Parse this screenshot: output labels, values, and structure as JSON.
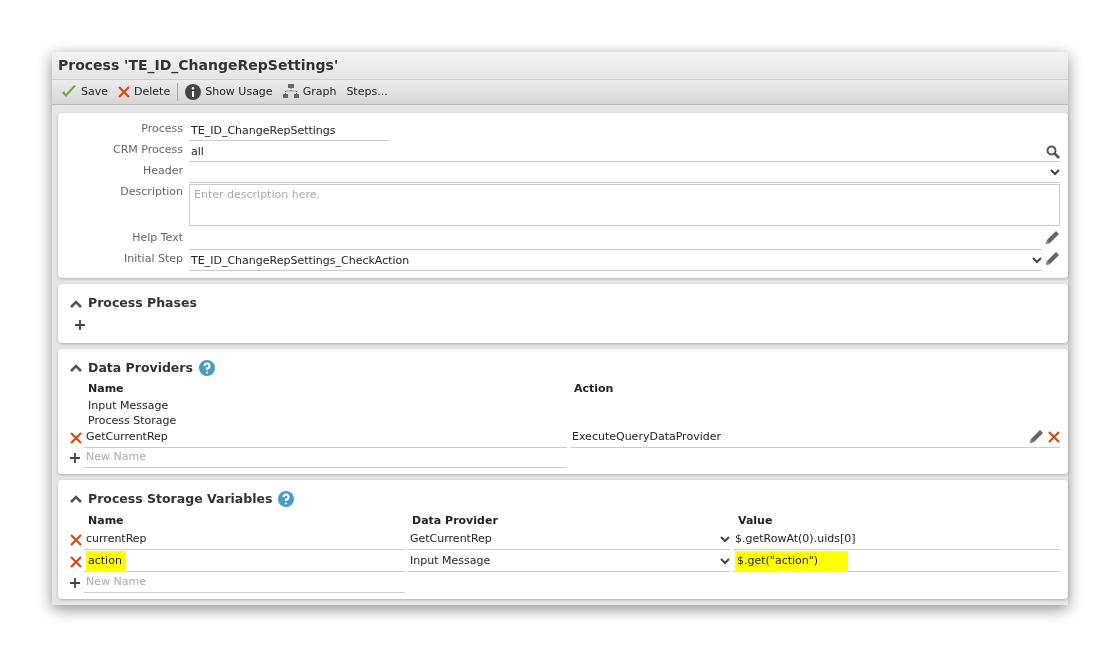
{
  "window": {
    "title": "Process 'TE_ID_ChangeRepSettings'"
  },
  "toolbar": {
    "groups": [
      [
        {
          "kind": "save",
          "label": "Save"
        },
        {
          "kind": "delete",
          "label": "Delete"
        }
      ],
      [
        {
          "kind": "info",
          "label": "Show Usage"
        },
        {
          "kind": "graph",
          "label": "Graph"
        },
        {
          "kind": "plain",
          "label": "Steps..."
        }
      ]
    ]
  },
  "form": {
    "fields": [
      {
        "label": "Process",
        "kind": "text",
        "value": "TE_ID_ChangeRepSettings"
      },
      {
        "label": "CRM Process",
        "kind": "search",
        "value": "all"
      },
      {
        "label": "Header",
        "kind": "select"
      },
      {
        "label": "Description",
        "kind": "textarea",
        "placeholder": "Enter description here."
      },
      {
        "label": "Help Text",
        "kind": "edit"
      },
      {
        "label": "Initial Step",
        "kind": "select-edit",
        "value": "TE_ID_ChangeRepSettings_CheckAction"
      }
    ]
  },
  "sections": [
    {
      "kind": "phases",
      "title": "Process Phases",
      "expanded": true,
      "help": false
    },
    {
      "kind": "providers",
      "title": "Data Providers",
      "expanded": true,
      "help": true,
      "columns": [
        "Name",
        "Action"
      ],
      "fixed_items": [
        "Input Message",
        "Process Storage"
      ],
      "rows": [
        {
          "name": "GetCurrentRep",
          "action": "ExecuteQueryDataProvider"
        }
      ],
      "new_placeholder": "New Name"
    },
    {
      "kind": "variables",
      "title": "Process Storage Variables",
      "expanded": true,
      "help": true,
      "columns": [
        "Name",
        "Data Provider",
        "Value"
      ],
      "rows": [
        {
          "name": "currentRep",
          "provider": "GetCurrentRep",
          "value": "$.getRowAt(0).uids[0]",
          "highlighted": false
        },
        {
          "name": "action",
          "provider": "Input Message",
          "value": "$.get(\"action\")",
          "highlighted": true
        }
      ],
      "new_placeholder": "New Name"
    }
  ]
}
